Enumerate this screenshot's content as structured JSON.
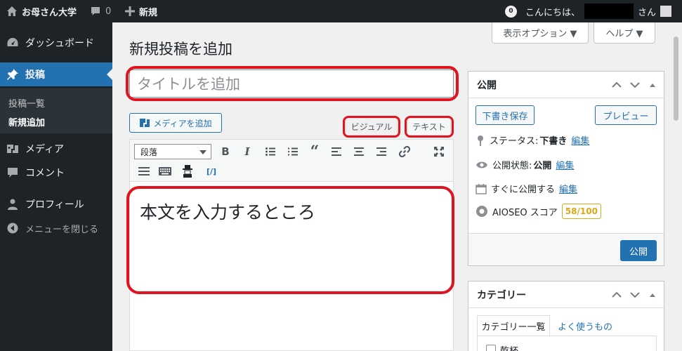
{
  "admin_bar": {
    "site_name": "お母さん大学",
    "comments_count": "0",
    "new_label": "新規",
    "notif_count": "0",
    "greeting": "こんにちは、",
    "honorific": "さん"
  },
  "sidebar": {
    "dashboard": "ダッシュボード",
    "posts": "投稿",
    "posts_list": "投稿一覧",
    "add_new": "新規追加",
    "media": "メディア",
    "comments": "コメント",
    "profile": "プロフィール",
    "collapse": "メニューを閉じる"
  },
  "screen_options": {
    "display_options": "表示オプション ▼",
    "help": "ヘルプ ▼"
  },
  "page": {
    "title": "新規投稿を追加",
    "title_placeholder": "タイトルを追加"
  },
  "editor": {
    "add_media": "メディアを追加",
    "tab_visual": "ビジュアル",
    "tab_text": "テキスト",
    "format_select": "段落",
    "body_text": "本文を入力するところ"
  },
  "publish_box": {
    "title": "公開",
    "save_draft": "下書き保存",
    "preview": "プレビュー",
    "status_label": "ステータス:",
    "status_value": "下書き",
    "visibility_label": "公開状態:",
    "visibility_value": "公開",
    "schedule_label": "すぐに公開する",
    "edit_link": "編集",
    "aioseo_label": "AIOSEO スコア",
    "aioseo_score": "58/100",
    "publish_button": "公開"
  },
  "category_box": {
    "title": "カテゴリー",
    "tab_all": "カテゴリー一覧",
    "tab_popular": "よく使うもの",
    "first_item": "乾杯"
  },
  "colors": {
    "admin_dark": "#1d2327",
    "accent": "#2271b1",
    "annotation_red": "#e0141e",
    "score_orange": "#dba617"
  }
}
